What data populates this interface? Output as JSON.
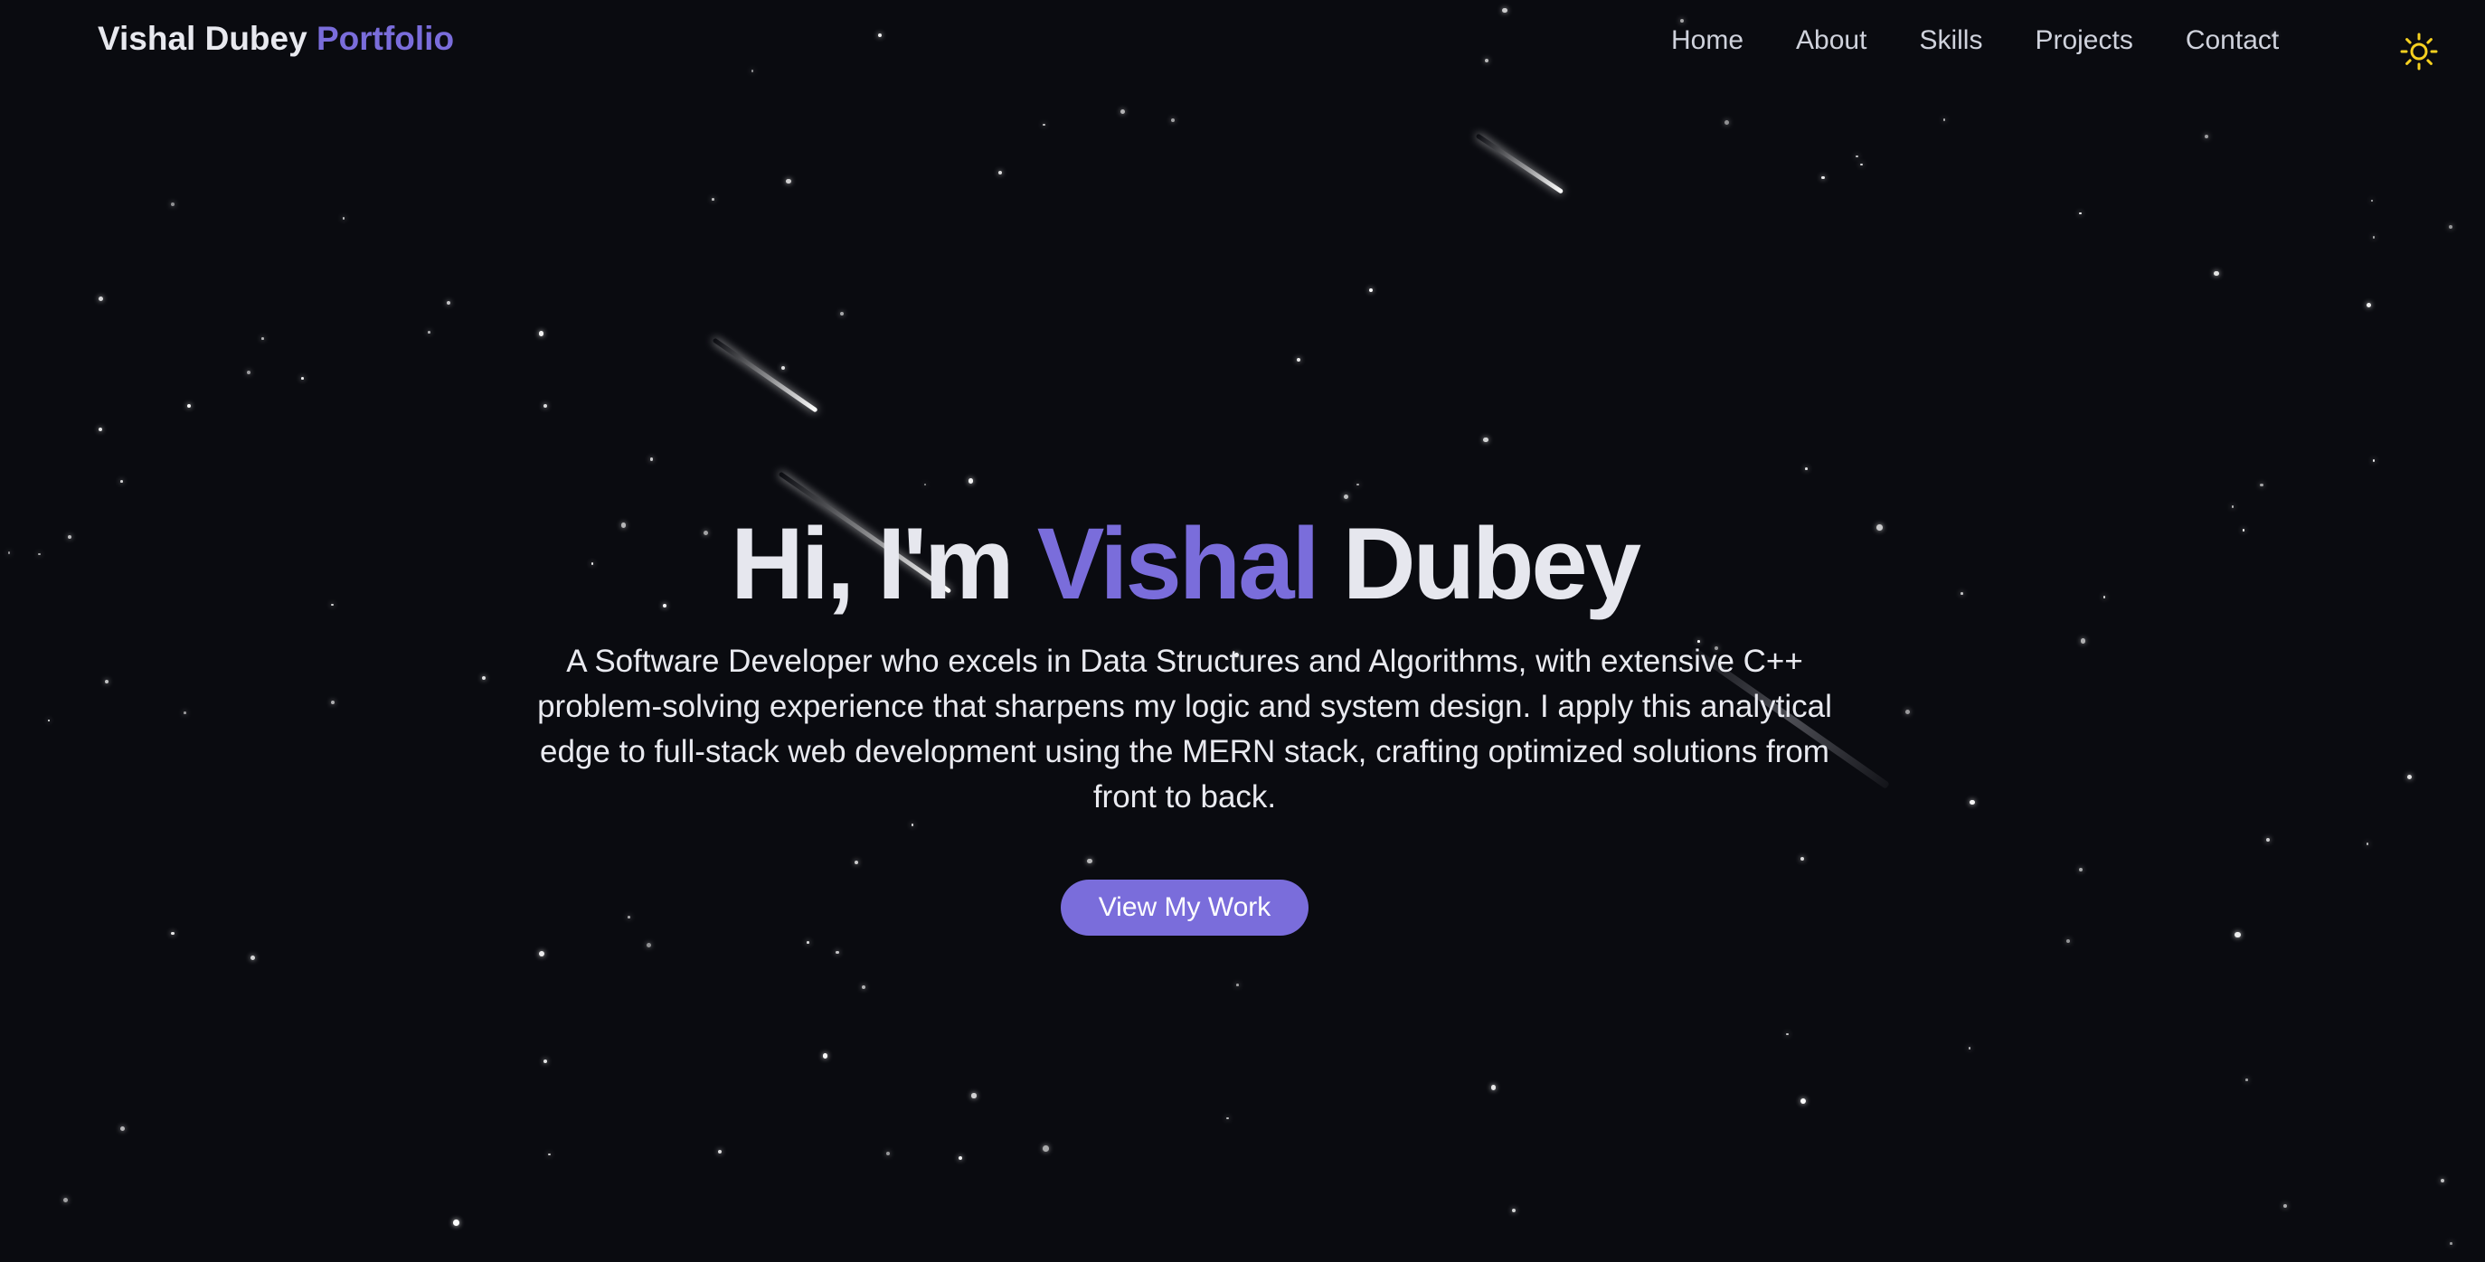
{
  "header": {
    "brand_name": "Vishal Dubey",
    "brand_accent": "Portfolio",
    "nav": [
      {
        "label": "Home"
      },
      {
        "label": "About"
      },
      {
        "label": "Skills"
      },
      {
        "label": "Projects"
      },
      {
        "label": "Contact"
      }
    ],
    "theme_toggle_icon": "sun-icon"
  },
  "hero": {
    "greeting": "Hi, I'm",
    "first_name": "Vishal",
    "last_name": "Dubey",
    "description": "A Software Developer who excels in Data Structures and Algorithms, with extensive C++ problem-solving experience that sharpens my logic and system design. I apply this analytical edge to full-stack web development using the MERN stack, crafting optimized solutions from front to back.",
    "cta_label": "View My Work"
  },
  "colors": {
    "background": "#0a0b10",
    "accent": "#7a6ddb",
    "text": "#e6e7ee",
    "sun": "#f5d020"
  }
}
